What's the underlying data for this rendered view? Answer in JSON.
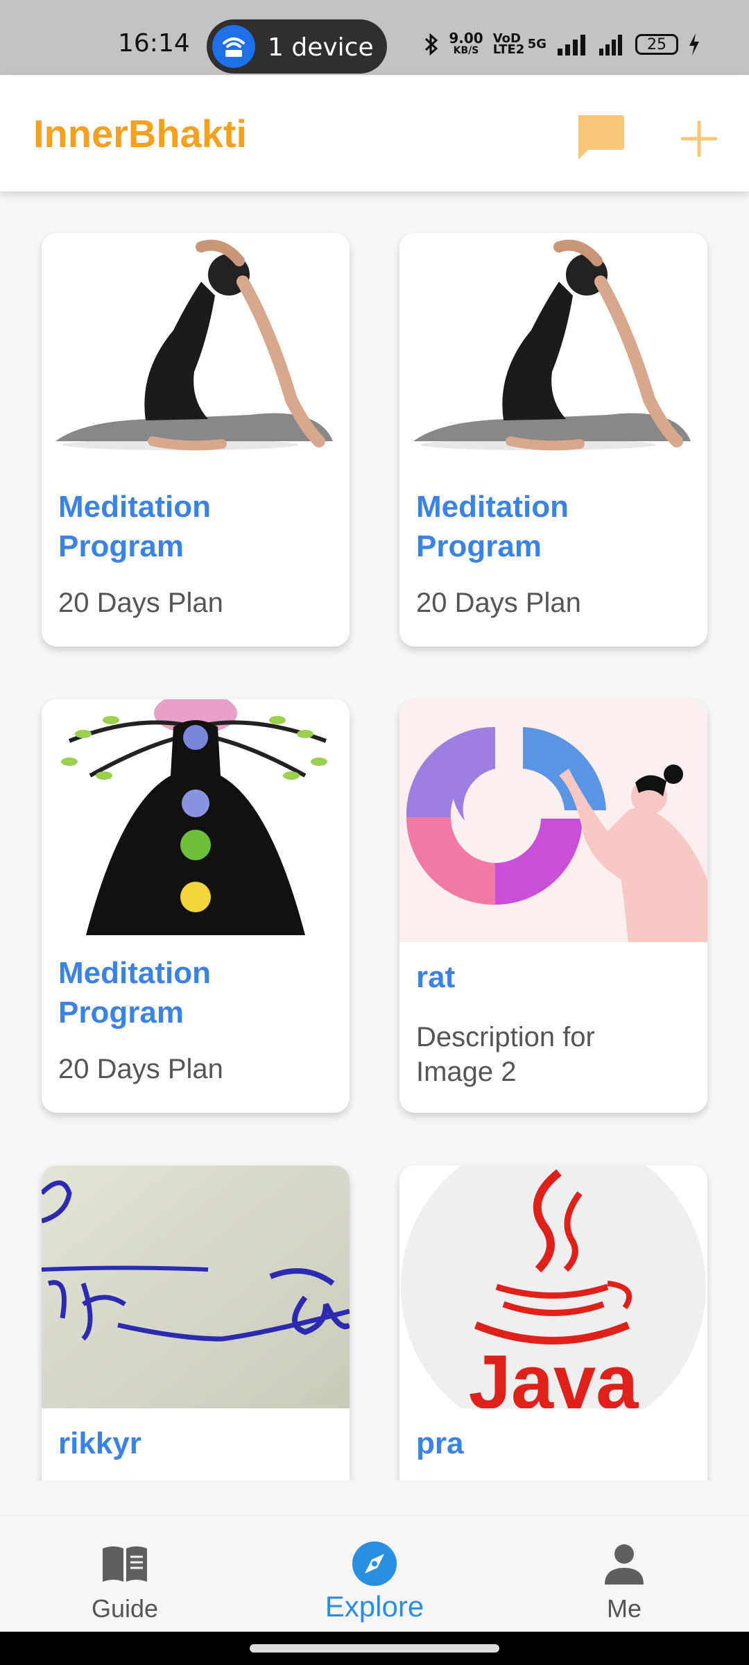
{
  "status_bar": {
    "time": "16:14",
    "hotspot": "1 device",
    "speed_value": "9.00",
    "speed_unit": "KB/S",
    "volte": "VoD LTE2",
    "network": "5G",
    "battery": "25"
  },
  "app_bar": {
    "title": "InnerBhakti",
    "chat_icon": "chat-bubble-icon",
    "add_icon": "plus-icon",
    "accent": "#f5a01e"
  },
  "cards": [
    {
      "title_line1": "Meditation",
      "title_line2": "Program",
      "desc_line1": "20 Days Plan",
      "desc_line2": "",
      "image": "yoga-pose"
    },
    {
      "title_line1": "Meditation",
      "title_line2": "Program",
      "desc_line1": "20 Days Plan",
      "desc_line2": "",
      "image": "yoga-pose"
    },
    {
      "title_line1": "Meditation",
      "title_line2": "Program",
      "desc_line1": "20 Days Plan",
      "desc_line2": "",
      "image": "chakra-tree"
    },
    {
      "title_line1": "rat",
      "title_line2": "",
      "desc_line1": "Description for",
      "desc_line2": "Image 2",
      "image": "donut-chart-illustration"
    },
    {
      "title_line1": "rikkyr",
      "title_line2": "",
      "desc_line1": "",
      "desc_line2": "",
      "image": "handwriting-photo"
    },
    {
      "title_line1": "pra",
      "title_line2": "",
      "desc_line1": "",
      "desc_line2": "",
      "image": "java-logo"
    }
  ],
  "java_logo_text": "Java",
  "bottom_nav": {
    "items": [
      {
        "label": "Guide",
        "icon": "book-icon"
      },
      {
        "label": "Explore",
        "icon": "compass-icon",
        "active": true
      },
      {
        "label": "Me",
        "icon": "person-icon"
      }
    ],
    "active_color": "#2a8fe0"
  }
}
